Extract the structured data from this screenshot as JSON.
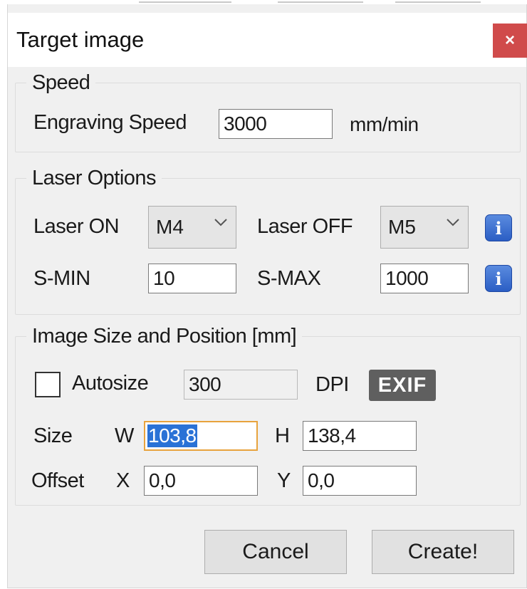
{
  "window": {
    "title": "Target image",
    "close_label": "×"
  },
  "speed": {
    "group_label": "Speed",
    "engraving_label": "Engraving Speed",
    "engraving_value": "3000",
    "unit": "mm/min"
  },
  "laser": {
    "group_label": "Laser Options",
    "on_label": "Laser ON",
    "on_value": "M4",
    "off_label": "Laser OFF",
    "off_value": "M5",
    "smin_label": "S-MIN",
    "smin_value": "10",
    "smax_label": "S-MAX",
    "smax_value": "1000",
    "info_glyph": "i"
  },
  "image": {
    "group_label": "Image Size and Position [mm]",
    "autosize_label": "Autosize",
    "autosize_checked": false,
    "dpi_value": "300",
    "dpi_label": "DPI",
    "exif_label": "EXIF",
    "size_label": "Size",
    "w_label": "W",
    "w_value": "103,8",
    "h_label": "H",
    "h_value": "138,4",
    "offset_label": "Offset",
    "x_label": "X",
    "x_value": "0,0",
    "y_label": "Y",
    "y_value": "0,0"
  },
  "buttons": {
    "cancel": "Cancel",
    "create": "Create!"
  },
  "colors": {
    "close_bg": "#d04b4b",
    "dialog_bg": "#f0f0f0",
    "focus_border": "#e8a33d",
    "selection": "#2a72d6",
    "info_blue": "#2b5ec4",
    "exif_bg": "#5f5f5f"
  }
}
